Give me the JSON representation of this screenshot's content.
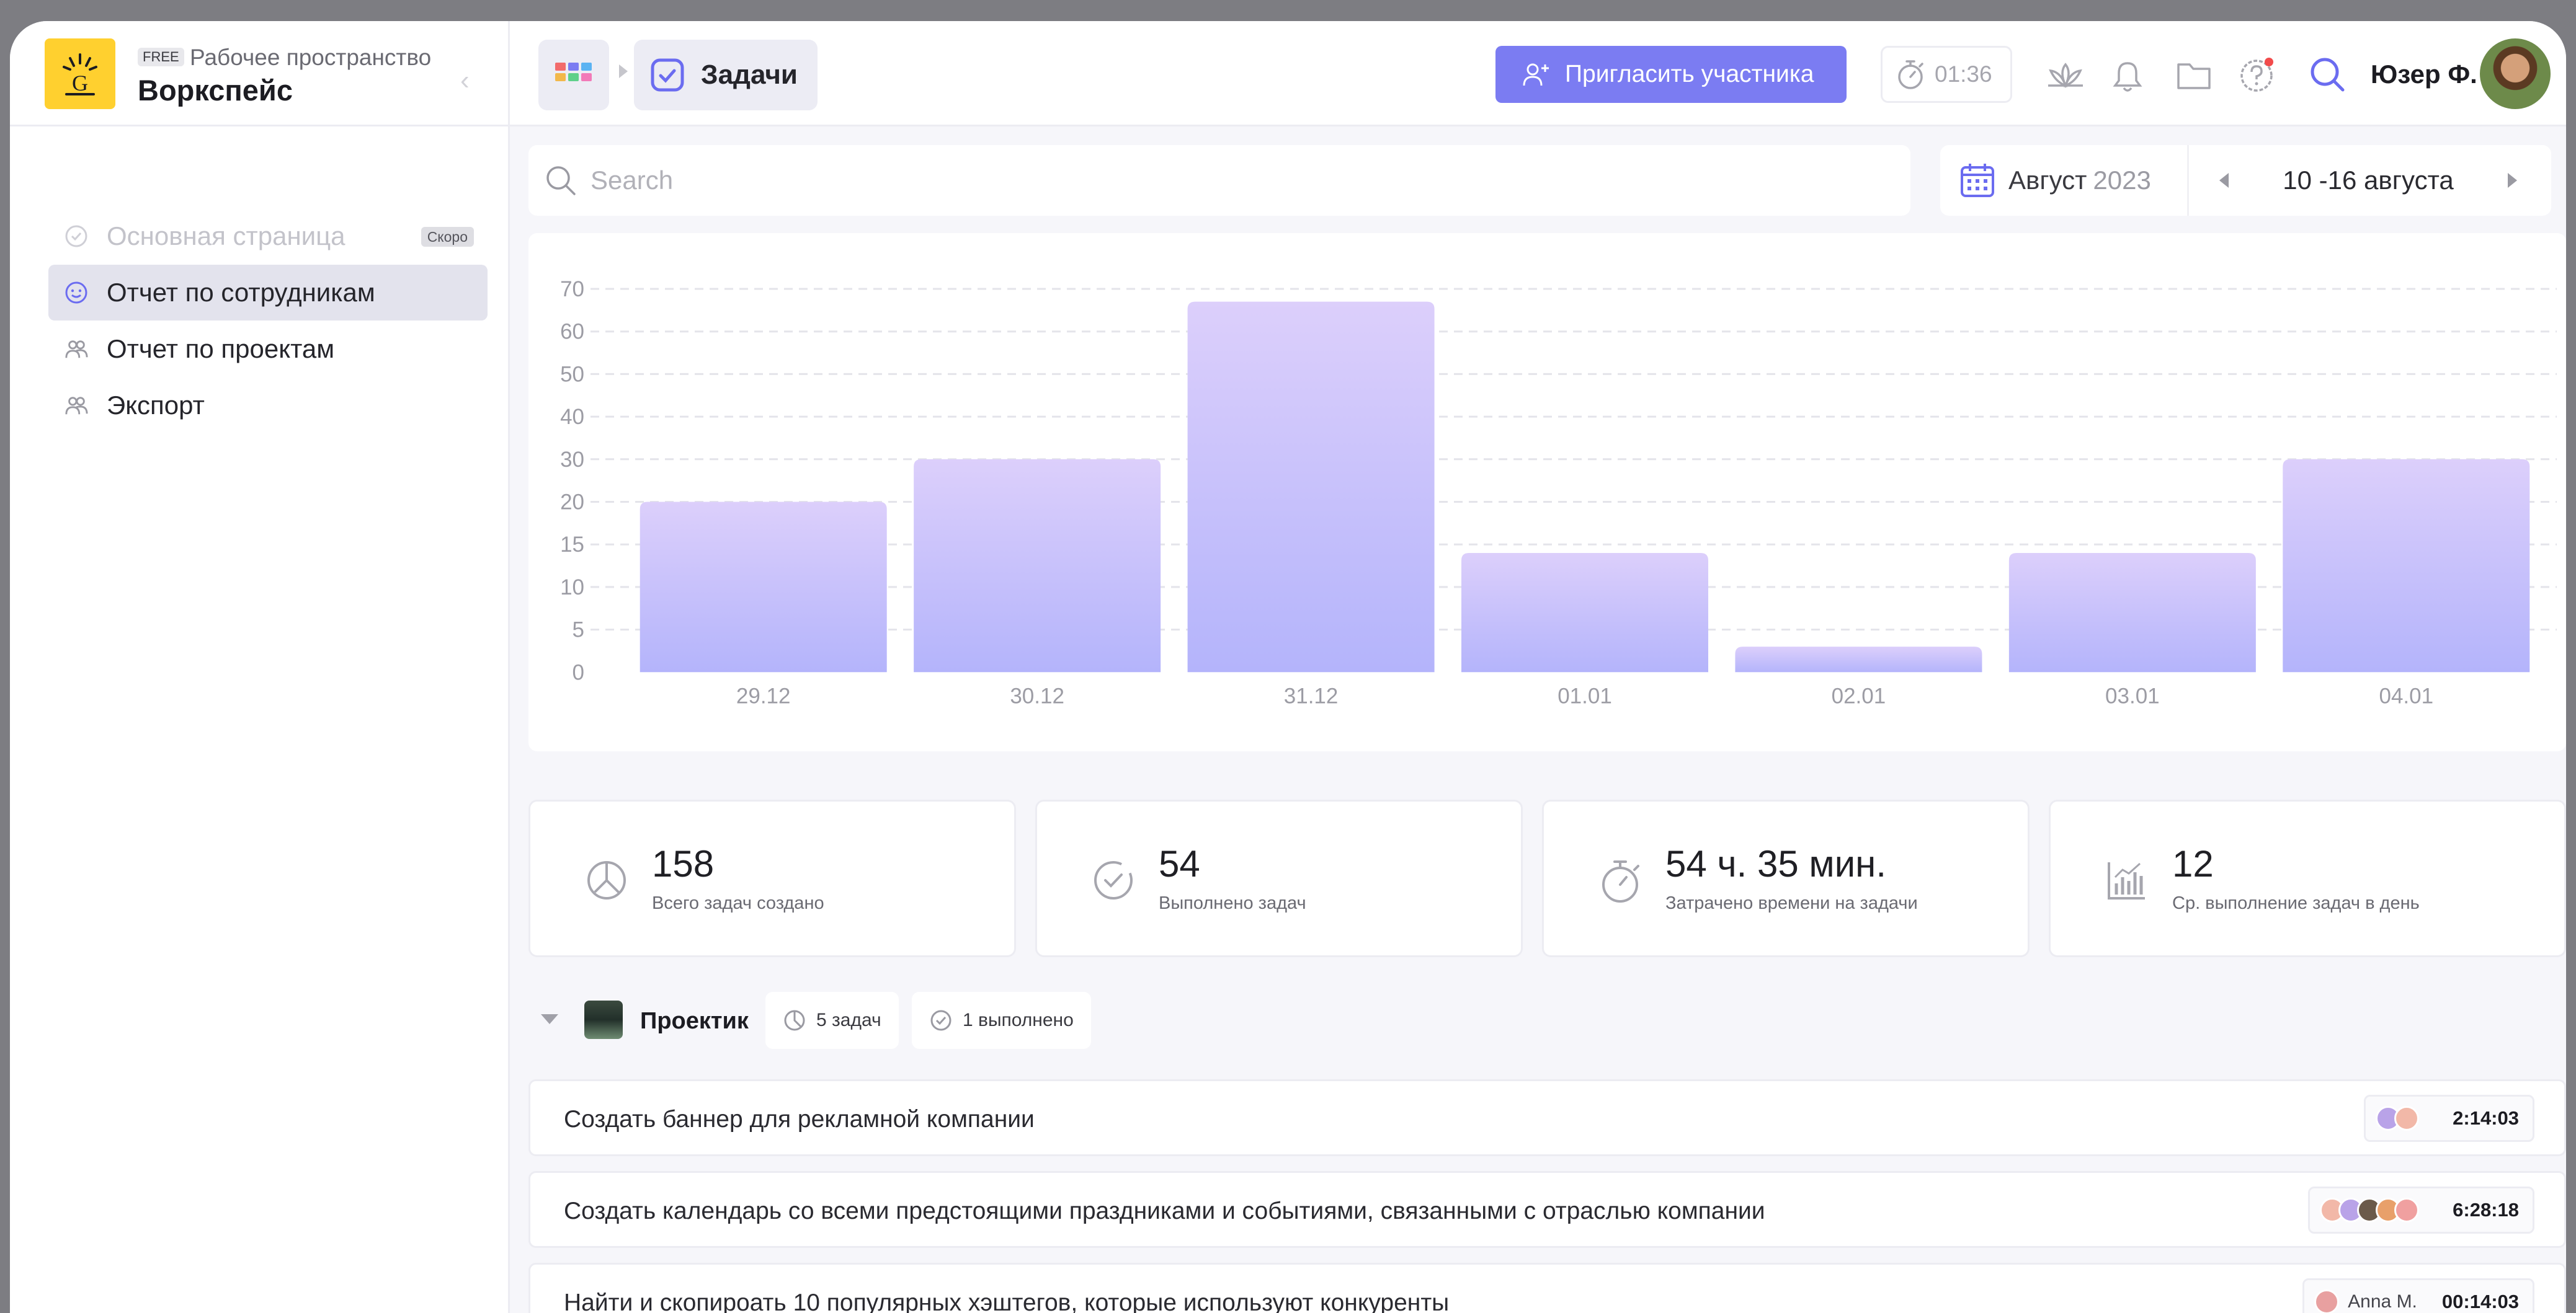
{
  "workspace": {
    "plan_badge": "FREE",
    "subtitle": "Рабочее пространство",
    "name": "Воркспейс",
    "logo_letter": "G"
  },
  "sidebar": {
    "items": [
      {
        "label": "Основная страница",
        "badge": "Скоро",
        "state": "disabled",
        "icon": "check-circle-icon"
      },
      {
        "label": "Отчет по сотрудникам",
        "state": "active",
        "icon": "smile-icon"
      },
      {
        "label": "Отчет по проектам",
        "state": "normal",
        "icon": "users-icon"
      },
      {
        "label": "Экспорт",
        "state": "normal",
        "icon": "users-icon"
      }
    ]
  },
  "topbar": {
    "breadcrumb": "Задачи",
    "invite_label": "Пригласить участника",
    "timer": "01:36",
    "user_name": "Юзер Ф.",
    "accent": "#7b7cf2"
  },
  "search": {
    "placeholder": "Search"
  },
  "date": {
    "month": "Август",
    "year": "2023",
    "week": "10 -16 августа"
  },
  "chart_data": {
    "type": "bar",
    "categories": [
      "29.12",
      "30.12",
      "31.12",
      "01.01",
      "02.01",
      "03.01",
      "04.01"
    ],
    "values": [
      20,
      30,
      67,
      14,
      3,
      14,
      30
    ],
    "y_ticks": [
      0,
      5,
      10,
      15,
      20,
      30,
      40,
      50,
      60,
      70
    ],
    "grid": true,
    "bar_color_top": "#dccffb",
    "bar_color_bottom": "#b4b4fb"
  },
  "stats": [
    {
      "value": "158",
      "caption": "Всего задач создано",
      "icon": "pie-chart-icon"
    },
    {
      "value": "54",
      "caption": "Выполнено задач",
      "icon": "check-circle-icon"
    },
    {
      "value": "54 ч. 35 мин.",
      "caption": "Затрачено времени на задачи",
      "icon": "stopwatch-icon"
    },
    {
      "value": "12",
      "caption": "Ср. выполнение задач в день",
      "icon": "bar-chart-icon"
    }
  ],
  "project": {
    "name": "Проектик",
    "tasks_chip": "5 задач",
    "done_chip": "1 выполнено"
  },
  "tasks": [
    {
      "title": "Создать баннер для рекламной компании",
      "assignee": "",
      "duration": "2:14:03",
      "faces": [
        "#b9a3e8",
        "#f2b8a8"
      ]
    },
    {
      "title": "Создать календарь со всеми предстоящими праздниками и событиями, связанными с отраслью компании",
      "assignee": "",
      "duration": "6:28:18",
      "faces": [
        "#f2b8a8",
        "#b9a3e8",
        "#6b5a4a",
        "#e8a06a",
        "#f0a0a0"
      ]
    },
    {
      "title": "Найти и скопироать 10 популярных хэштегов, которые используют конкуренты",
      "assignee": "Anna M.",
      "duration": "00:14:03",
      "faces": [
        "#e8a0a0"
      ]
    }
  ]
}
